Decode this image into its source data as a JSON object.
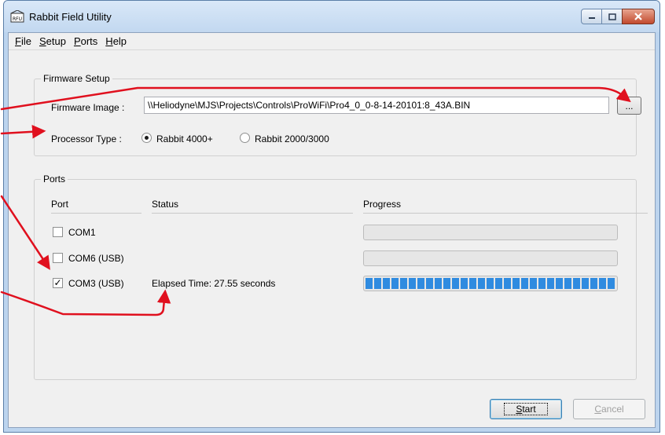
{
  "window": {
    "title": "Rabbit Field Utility",
    "app_icon": "rfu-rabbit-icon",
    "buttons": [
      "minimize-icon",
      "maximize-icon",
      "close-icon"
    ]
  },
  "menu": {
    "items": [
      {
        "first": "F",
        "rest": "ile"
      },
      {
        "first": "S",
        "rest": "etup"
      },
      {
        "first": "P",
        "rest": "orts"
      },
      {
        "first": "H",
        "rest": "elp"
      }
    ]
  },
  "firmware": {
    "group_label": "Firmware Setup",
    "image_label": "Firmware Image :",
    "image_value": "\\\\Heliodyne\\MJS\\Projects\\Controls\\ProWiFi\\Pro4_0_0-8-14-20101:8_43A.BIN",
    "browse_label": "...",
    "processor_label": "Processor Type :",
    "processor_options": [
      "Rabbit 4000+",
      "Rabbit 2000/3000"
    ],
    "processor_selected": "Rabbit 4000+"
  },
  "ports": {
    "group_label": "Ports",
    "columns": [
      "Port",
      "Status",
      "Progress"
    ],
    "rows": [
      {
        "name": "COM1",
        "checked": false,
        "status": "",
        "progress": 0
      },
      {
        "name": "COM6 (USB)",
        "checked": false,
        "status": "",
        "progress": 0
      },
      {
        "name": "COM3 (USB)",
        "checked": true,
        "status": "Elapsed Time: 27.55 seconds",
        "progress": 1.0
      }
    ]
  },
  "actions": {
    "start_label": "Start",
    "start_accel": "S",
    "cancel_label": "Cancel",
    "cancel_accel": "C"
  },
  "colors": {
    "annotation_arrow": "#e0101e",
    "progress_fill": "#2f8be0"
  }
}
